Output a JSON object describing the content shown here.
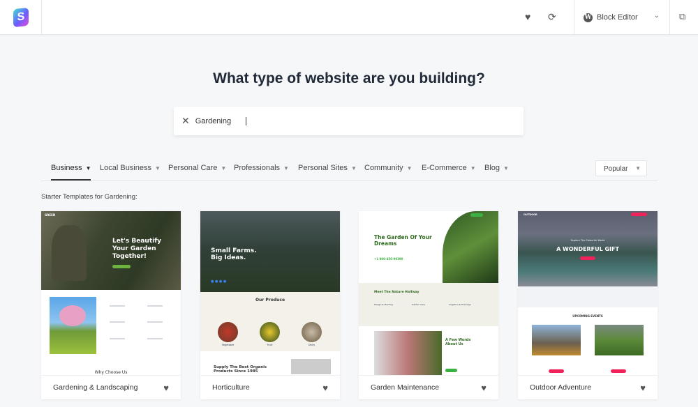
{
  "header": {
    "logo_icon": "starter-templates-logo",
    "favorites_icon": "heart-icon",
    "sync_icon": "refresh-icon",
    "editor_label": "Block Editor",
    "editor_icon": "wordpress-icon",
    "external_icon": "external-link-icon"
  },
  "title": "What type of website are you building?",
  "search": {
    "value": "Gardening",
    "clear_icon": "close-icon"
  },
  "categories": [
    {
      "label": "Business",
      "active": true
    },
    {
      "label": "Local Business"
    },
    {
      "label": "Personal Care"
    },
    {
      "label": "Professionals"
    },
    {
      "label": "Personal Sites"
    },
    {
      "label": "Community"
    },
    {
      "label": "E-Commerce"
    },
    {
      "label": "Blog"
    }
  ],
  "sort": {
    "selected": "Popular"
  },
  "results_label": "Starter Templates for Gardening:",
  "templates": [
    {
      "name": "Gardening & Landscaping",
      "headline": "Let's Beautify Your Garden Together!",
      "brand": "GREEN",
      "section": "Why Choose Us"
    },
    {
      "name": "Horticulture",
      "headline": "Small Farms. Big Ideas.",
      "section": "Our Produce",
      "items": [
        "Vegetable",
        "Fruit",
        "Dairy"
      ],
      "section2": "Supply The Best Organic Products Since 1985"
    },
    {
      "name": "Garden Maintenance",
      "headline": "The Garden Of Your Dreams",
      "phone": "+1 800-456-90390",
      "section": "Meet The Nature Halfway",
      "services": [
        "Design & Planting",
        "Garden Care",
        "Irrigation & Drainage"
      ],
      "about": "A Few Words About Us"
    },
    {
      "name": "Outdoor Adventure",
      "eyebrow": "Explore The Colourful World",
      "headline": "A WONDERFUL GIFT",
      "brand": "OUTDOOR",
      "section": "UPCOMING EVENTS"
    }
  ]
}
